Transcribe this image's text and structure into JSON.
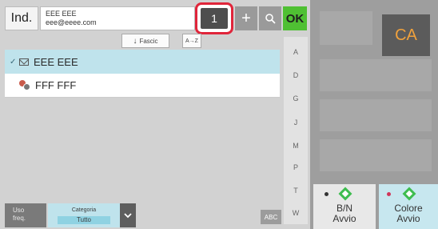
{
  "header": {
    "ind_label": "Ind.",
    "recipient_name": "EEE EEE",
    "recipient_email": "eee@eeee.com",
    "copies_count": "1",
    "plus_label": "+",
    "ok_label": "OK"
  },
  "sort": {
    "fascic_label": "Fascic",
    "fascic_arrow": "↓",
    "abc_sort_label": "A→Z"
  },
  "contacts": [
    {
      "name": "EEE EEE",
      "type": "email",
      "selected": true
    },
    {
      "name": "FFF FFF",
      "type": "group",
      "selected": false
    }
  ],
  "alphabet_index": [
    "A",
    "D",
    "G",
    "J",
    "M",
    "P",
    "T",
    "W"
  ],
  "bottom": {
    "uso_label_1": "Uso",
    "uso_label_2": "freq.",
    "categoria_label": "Categoria",
    "categoria_value": "Tutto",
    "abc_label": "ABC"
  },
  "right": {
    "ca_label": "CA",
    "bw_label_1": "B/N",
    "bw_label_2": "Avvio",
    "color_label_1": "Colore",
    "color_label_2": "Avvio"
  },
  "colors": {
    "accent_green": "#4fc033",
    "highlight_red": "#e0253a",
    "selection_blue": "#bfe3ec",
    "ca_orange": "#f0a13c"
  },
  "icons": [
    "plus-icon",
    "search-icon",
    "mail-icon",
    "group-icon",
    "chevron-down-icon",
    "start-diamond-icon"
  ]
}
